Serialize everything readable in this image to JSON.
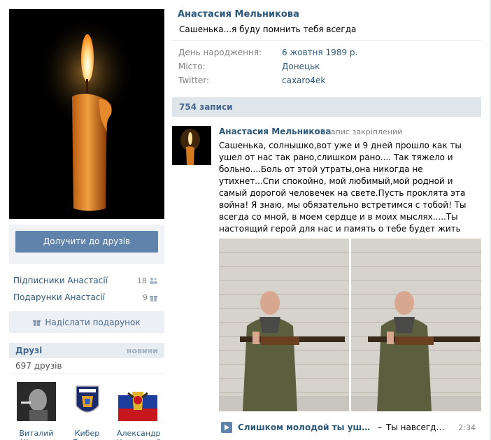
{
  "profile": {
    "name": "Анастасия Мельникова",
    "status": "Сашенька...я буду помнить тебя всегда",
    "info": [
      {
        "label": "День народження:",
        "value": "6 жовтня 1989 р."
      },
      {
        "label": "Місто:",
        "value": "Донецьк"
      },
      {
        "label": "Twitter:",
        "value": "caxaro4ek"
      }
    ]
  },
  "left": {
    "add_friend_button": "Долучити до друзів",
    "subscribers_label": "Підписники Анастасії",
    "subscribers_count": "18",
    "gifts_label": "Подарунки Анастасії",
    "gifts_count": "9",
    "send_gift_button": "Надіслати подарунок",
    "friends_title": "Друзі",
    "friends_news": "новини",
    "friends_count": "697 друзів",
    "friends": [
      {
        "name": "Виталий Шеппев"
      },
      {
        "name": "Кибер Беркут"
      },
      {
        "name": "Александр Черненкий"
      }
    ]
  },
  "wall": {
    "posts_count": "754 записи",
    "post": {
      "author": "Анастасия Мельникова",
      "pinned": "запис закріплений",
      "text": "Сашенька, солнышко,вот уже и 9 дней прошло как ты ушел от нас так рано,слишком рано.... Так тяжело и больно....Боль от этой утраты,она никогда не утихнет...Спи спокойно, мой любимый,мой родной и самый дорогой человечек на свете.Пусть проклята эта война! Я знаю, мы обязательно встретимся с тобой! Ты всегда со мной, в моем сердце и в моих мыслях.....Ты настоящий герой для нас и память о тебе будет жить всегда.",
      "audio": {
        "title": "Слишком молодой ты ушел о...",
        "dash": "–",
        "artist": "Ты навсегда...",
        "duration": "2:34"
      }
    }
  },
  "colors": {
    "link": "#2b587a",
    "button": "#5f83aa",
    "header_bg": "#dee5eb"
  }
}
